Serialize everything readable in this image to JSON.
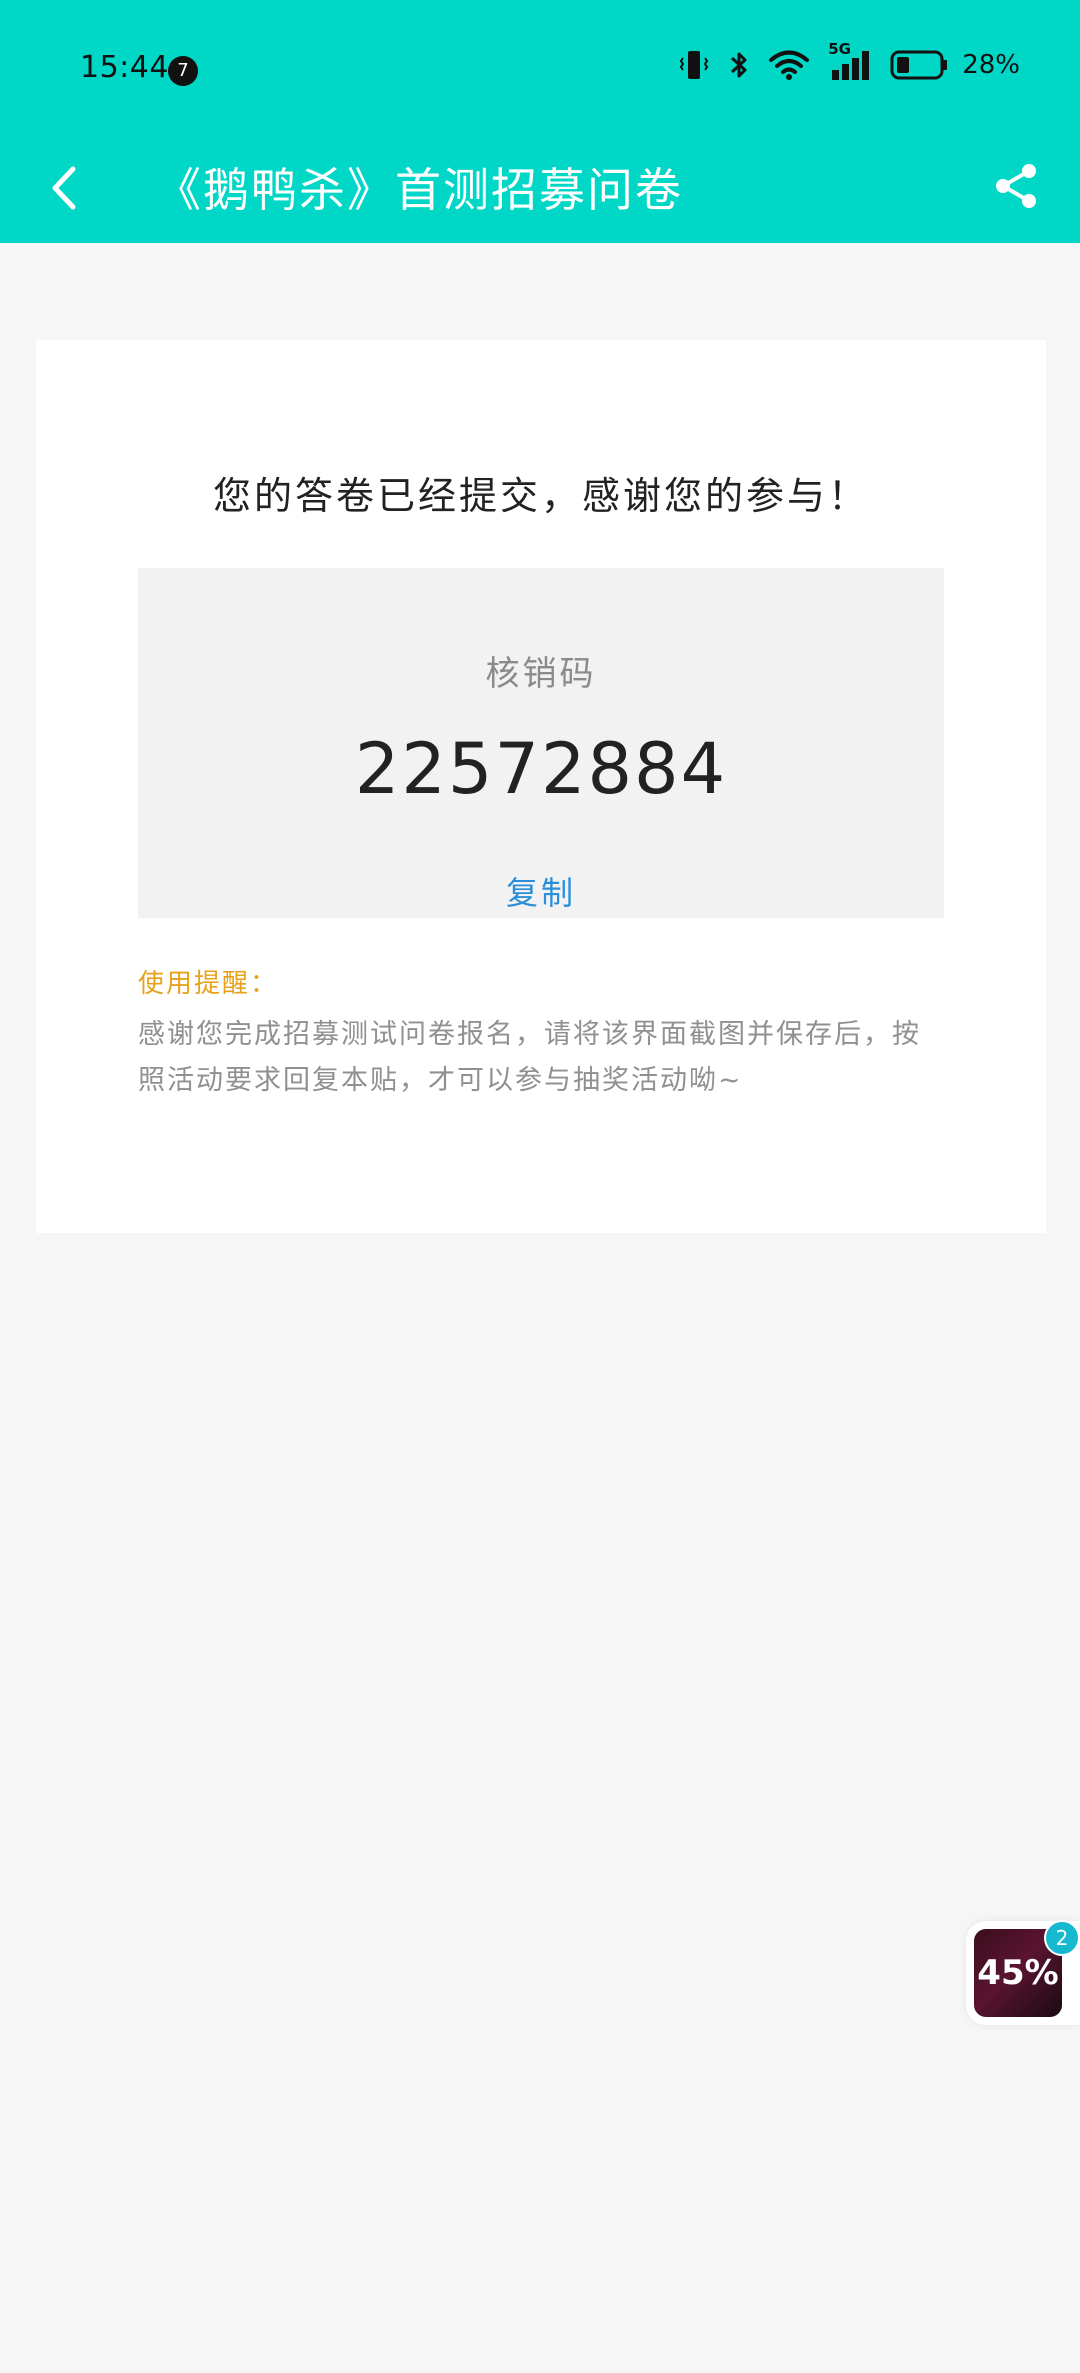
{
  "status_bar": {
    "time": "15:44",
    "notification_count": "7",
    "network": "5G",
    "battery": "28%"
  },
  "nav": {
    "title": "《鹅鸭杀》首测招募问卷"
  },
  "result": {
    "message": "您的答卷已经提交，感谢您的参与！",
    "code_label": "核销码",
    "code_value": "22572884",
    "copy_label": "复制",
    "tip_title": "使用提醒：",
    "tip_body": "感谢您完成招募测试问卷报名，请将该界面截图并保存后，按照活动要求回复本贴，才可以参与抽奖活动呦~"
  },
  "floating_widget": {
    "progress_text": "45%",
    "badge_count": "2"
  },
  "colors": {
    "header": "#00d7c6",
    "page_bg": "#f6f6f7",
    "link": "#2a8fd8",
    "tip_title": "#e8a11b"
  }
}
